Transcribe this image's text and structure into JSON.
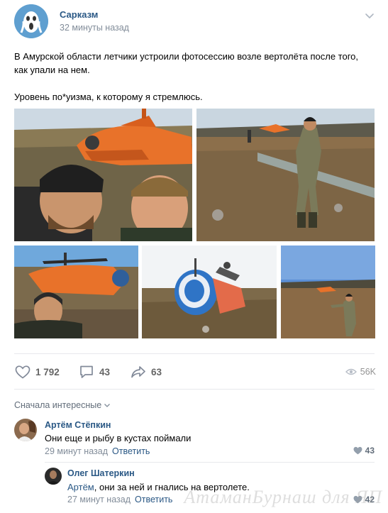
{
  "post": {
    "author": "Сарказм",
    "time": "32 минуты назад",
    "text_line1": "В Амурской области летчики устроили фотосессию возле вертолёта после того, как упали на нем.",
    "text_line2": "Уровень по*уизма, к которому я стремлюсь."
  },
  "photos": [
    {
      "name": "selfie-with-crashed-helicopter"
    },
    {
      "name": "man-standing-near-wreck"
    },
    {
      "name": "selfie-in-front-of-helicopter"
    },
    {
      "name": "overturned-blue-helicopter"
    },
    {
      "name": "man-in-field-with-wreck"
    }
  ],
  "actions": {
    "likes": "1 792",
    "comments": "43",
    "shares": "63",
    "views": "56K"
  },
  "comments_section": {
    "sort_label": "Сначала интересные"
  },
  "comments": [
    {
      "author": "Артём Стёпкин",
      "text": "Они еще и рыбу в кустах поймали",
      "time": "29 минут назад",
      "reply_label": "Ответить",
      "likes": "43"
    },
    {
      "author": "Олег Шатеркин",
      "mention": "Артём",
      "text": ", они за ней и гнались на вертолете.",
      "time": "27 минут назад",
      "reply_label": "Ответить",
      "likes": "42"
    }
  ],
  "watermark": "АтаманБурнаш для ЯП",
  "colors": {
    "link": "#2a5885",
    "meta": "#818c99",
    "divider": "#e7e8ec",
    "helicopter_orange": "#e8722a"
  }
}
